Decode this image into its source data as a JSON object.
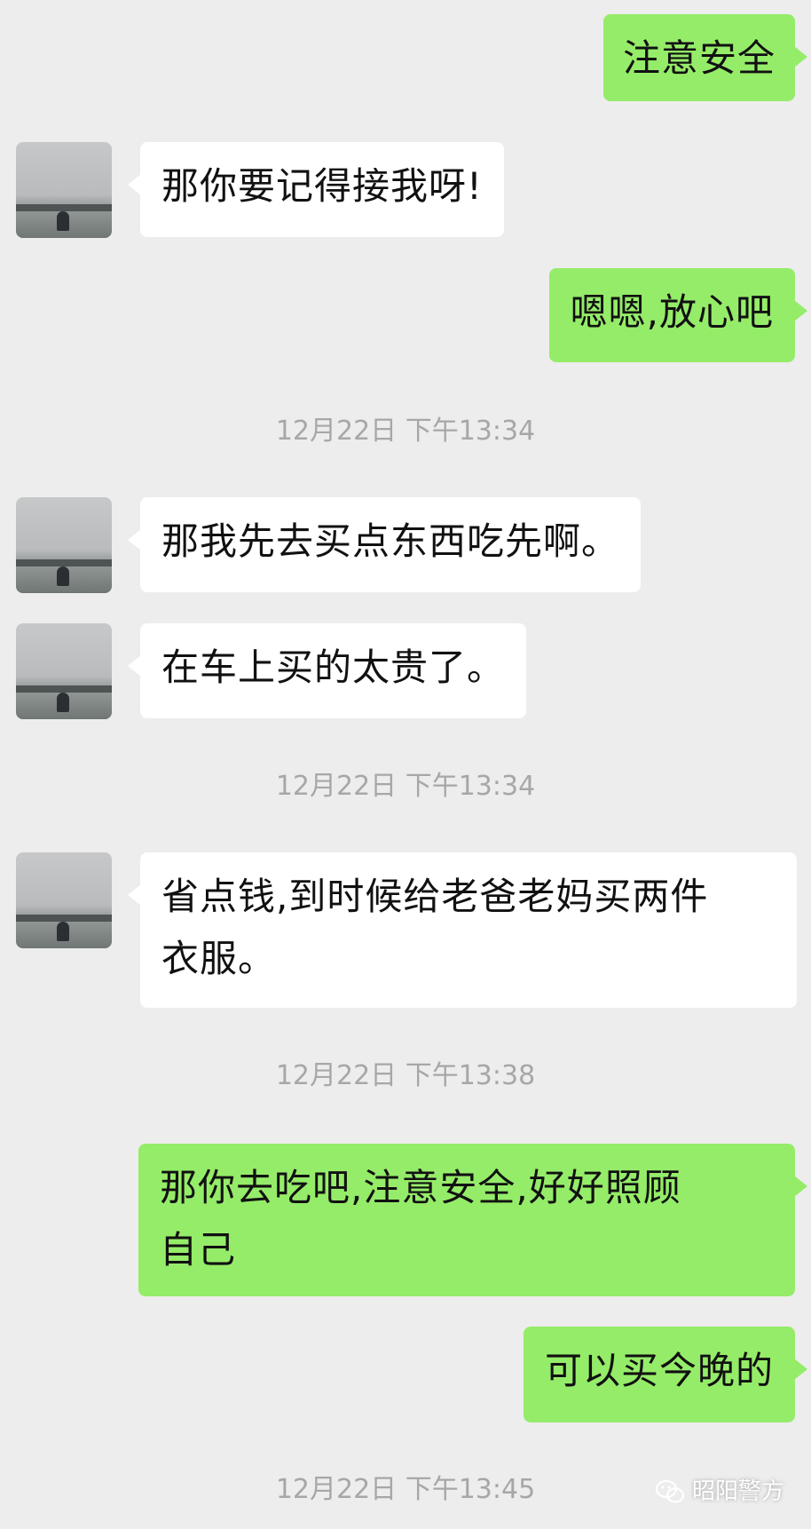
{
  "messages": [
    {
      "dir": "out",
      "text": "注意安全"
    },
    {
      "dir": "in",
      "text": "那你要记得接我呀!"
    },
    {
      "dir": "out",
      "text": "嗯嗯,放心吧"
    },
    {
      "timestamp": "12月22日 下午13:34"
    },
    {
      "dir": "in",
      "text": "那我先去买点东西吃先啊。"
    },
    {
      "dir": "in",
      "text": "在车上买的太贵了。"
    },
    {
      "timestamp": "12月22日 下午13:34"
    },
    {
      "dir": "in",
      "line1": "省点钱,到时候给老爸老妈买两件",
      "line2": "衣服。"
    },
    {
      "timestamp": "12月22日 下午13:38"
    },
    {
      "dir": "out",
      "line1": "那你去吃吧,注意安全,好好照顾",
      "line2": "自己"
    },
    {
      "dir": "out",
      "text": "可以买今晚的"
    },
    {
      "timestamp": "12月22日 下午13:45"
    }
  ],
  "watermark": {
    "text": "昭阳警方",
    "icon": "wechat-icon"
  },
  "colors": {
    "background": "#ededed",
    "outgoing_bubble": "#95ec69",
    "incoming_bubble": "#ffffff",
    "timestamp": "#a7a7a7"
  }
}
